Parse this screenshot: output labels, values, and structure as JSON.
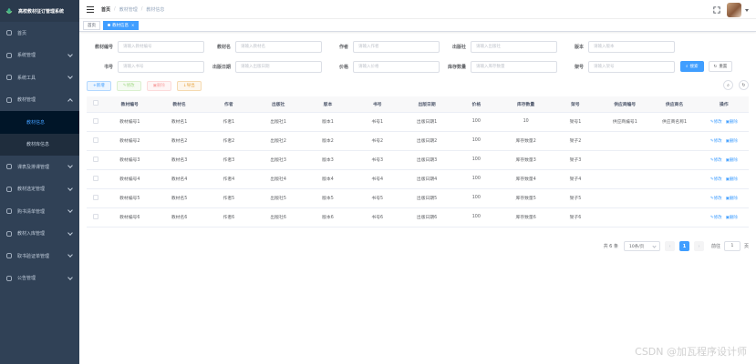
{
  "app": {
    "title": "高校教材征订管理系统"
  },
  "sidebar": {
    "items": [
      {
        "label": "首页",
        "icon": "dashboard-icon"
      },
      {
        "label": "系统管理",
        "icon": "gear-icon"
      },
      {
        "label": "系统工具",
        "icon": "tool-icon"
      },
      {
        "label": "教材管理",
        "icon": "book-icon"
      },
      {
        "label": "课表及排课管理",
        "icon": "calendar-icon"
      },
      {
        "label": "教材选定管理",
        "icon": "select-icon"
      },
      {
        "label": "购书清单管理",
        "icon": "list-icon"
      },
      {
        "label": "教材入库管理",
        "icon": "import-icon"
      },
      {
        "label": "取书验证单管理",
        "icon": "verify-icon"
      },
      {
        "label": "公告管理",
        "icon": "notice-icon"
      }
    ],
    "submenu": [
      {
        "label": "教材信息"
      },
      {
        "label": "教材库信息"
      }
    ]
  },
  "breadcrumb": {
    "home": "首页",
    "level1": "教材管理",
    "level2": "教材信息"
  },
  "tags": {
    "home": "首页",
    "active": "教材信息",
    "close": "×"
  },
  "search": {
    "row1": [
      {
        "label": "教材编号",
        "placeholder": "请输入教材编号"
      },
      {
        "label": "教材名",
        "placeholder": "请输入教材名"
      },
      {
        "label": "作者",
        "placeholder": "请输入作者"
      },
      {
        "label": "出版社",
        "placeholder": "请输入出版社"
      },
      {
        "label": "版本",
        "placeholder": "请输入版本"
      }
    ],
    "row2": [
      {
        "label": "书号",
        "placeholder": "请输入书号"
      },
      {
        "label": "出版日期",
        "placeholder": "请输入出版日期"
      },
      {
        "label": "价格",
        "placeholder": "请输入价格"
      },
      {
        "label": "库存数量",
        "placeholder": "请输入库存数量"
      },
      {
        "label": "架号",
        "placeholder": "请输入架号"
      }
    ],
    "search_label": "搜索",
    "reset_label": "重置"
  },
  "toolbar": {
    "add": "新增",
    "edit": "修改",
    "delete": "删除",
    "export": "导出"
  },
  "table": {
    "headers": [
      "教材编号",
      "教材名",
      "作者",
      "出版社",
      "版本",
      "书号",
      "出版日期",
      "价格",
      "库存数量",
      "架号",
      "供应商编号",
      "供应商名",
      "操作"
    ],
    "edit_label": "修改",
    "delete_label": "删除",
    "rows": [
      [
        "教材编号1",
        "教材名1",
        "作者1",
        "出版社1",
        "版本1",
        "书号1",
        "出版日期1",
        "100",
        "10",
        "架号1",
        "供应商编号1",
        "供应商名称1"
      ],
      [
        "教材编号2",
        "教材名2",
        "作者2",
        "出版社2",
        "版本2",
        "书号2",
        "出版日期2",
        "100",
        "库存数量2",
        "架子2",
        "",
        ""
      ],
      [
        "教材编号3",
        "教材名3",
        "作者3",
        "出版社3",
        "版本3",
        "书号3",
        "出版日期3",
        "100",
        "库存数量3",
        "架子3",
        "",
        ""
      ],
      [
        "教材编号4",
        "教材名4",
        "作者4",
        "出版社4",
        "版本4",
        "书号4",
        "出版日期4",
        "100",
        "库存数量4",
        "架子4",
        "",
        ""
      ],
      [
        "教材编号5",
        "教材名5",
        "作者5",
        "出版社5",
        "版本5",
        "书号5",
        "出版日期5",
        "100",
        "库存数量5",
        "架子5",
        "",
        ""
      ],
      [
        "教材编号6",
        "教材名6",
        "作者6",
        "出版社6",
        "版本6",
        "书号6",
        "出版日期6",
        "100",
        "库存数量6",
        "架子6",
        "",
        ""
      ]
    ]
  },
  "pagination": {
    "total": "共 6 条",
    "page_size": "10条/页",
    "current": "1",
    "goto_prefix": "前往",
    "goto_value": "1",
    "goto_suffix": "页"
  },
  "watermark": "CSDN @加瓦程序设计师"
}
